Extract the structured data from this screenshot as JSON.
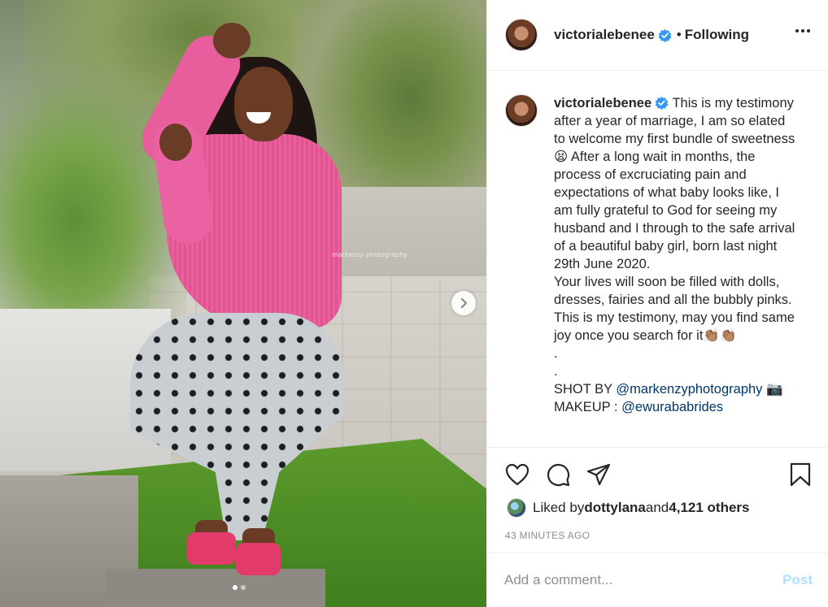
{
  "post": {
    "username": "victorialebenee",
    "follow_separator": "•",
    "follow_status": "Following",
    "photo_watermark": "markenzy photography",
    "carousel": {
      "total_slides": 2,
      "active_slide": 1
    }
  },
  "caption": {
    "username": "victorialebenee",
    "body": "This is my testimony after a year of marriage, I am so elated to welcome my first bundle of sweetness 😫 After a long wait in months, the process of excruciating pain and expectations of what baby looks like, I am fully grateful to God for seeing my husband and I through to the safe arrival of a beautiful baby girl, born last night 29th June 2020.\nYour lives will soon be filled with dolls, dresses, fairies and all the bubbly pinks.\nThis is my testimony, may you find same joy once you search for it👏🏽👏🏽\n.\n.\n",
    "shot_by_label": "SHOT BY ",
    "shot_by_mention": "@markenzyphotography",
    "shot_by_suffix": " 📷",
    "makeup_label": "MAKEUP : ",
    "makeup_mention": "@ewurababrides"
  },
  "likes": {
    "prefix": "Liked by ",
    "liker": "dottylana",
    "connector": " and ",
    "others": "4,121 others"
  },
  "timestamp": "43 MINUTES AGO",
  "comment": {
    "placeholder": "Add a comment...",
    "post_label": "Post"
  },
  "colors": {
    "verified_badge": "#3897f0",
    "mention_link": "#00376b",
    "post_disabled": "#b2dffc",
    "secondary_text": "#8e8e8e"
  },
  "icons": [
    "verified-icon",
    "more-icon",
    "chevron-right-icon",
    "heart-icon",
    "comment-icon",
    "share-icon",
    "bookmark-icon"
  ]
}
